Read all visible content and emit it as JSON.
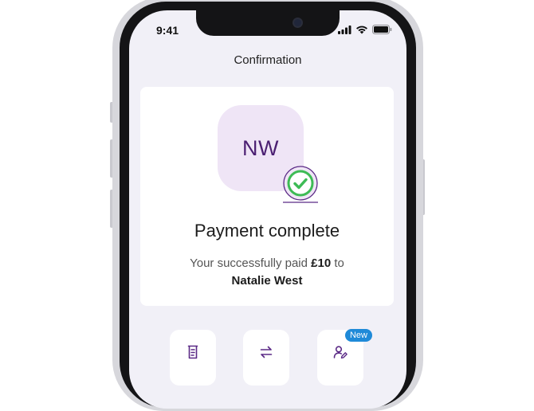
{
  "status_bar": {
    "time": "9:41"
  },
  "header": {
    "title": "Confirmation"
  },
  "confirmation": {
    "avatar_initials": "NW",
    "headline": "Payment complete",
    "message_prefix": "Your successfully paid",
    "amount": "£10",
    "message_connector": "to",
    "recipient": "Natalie West"
  },
  "actions": [
    {
      "icon": "receipt-icon"
    },
    {
      "icon": "transfer-icon"
    },
    {
      "icon": "edit-contact-icon",
      "badge": "New"
    }
  ],
  "colors": {
    "screen_bg": "#f1f0f7",
    "avatar_bg": "#efe5f6",
    "avatar_text": "#4b1f72",
    "success_green": "#3dbb55",
    "accent_purple": "#5b2a86",
    "badge_blue": "#1f8ad8"
  }
}
